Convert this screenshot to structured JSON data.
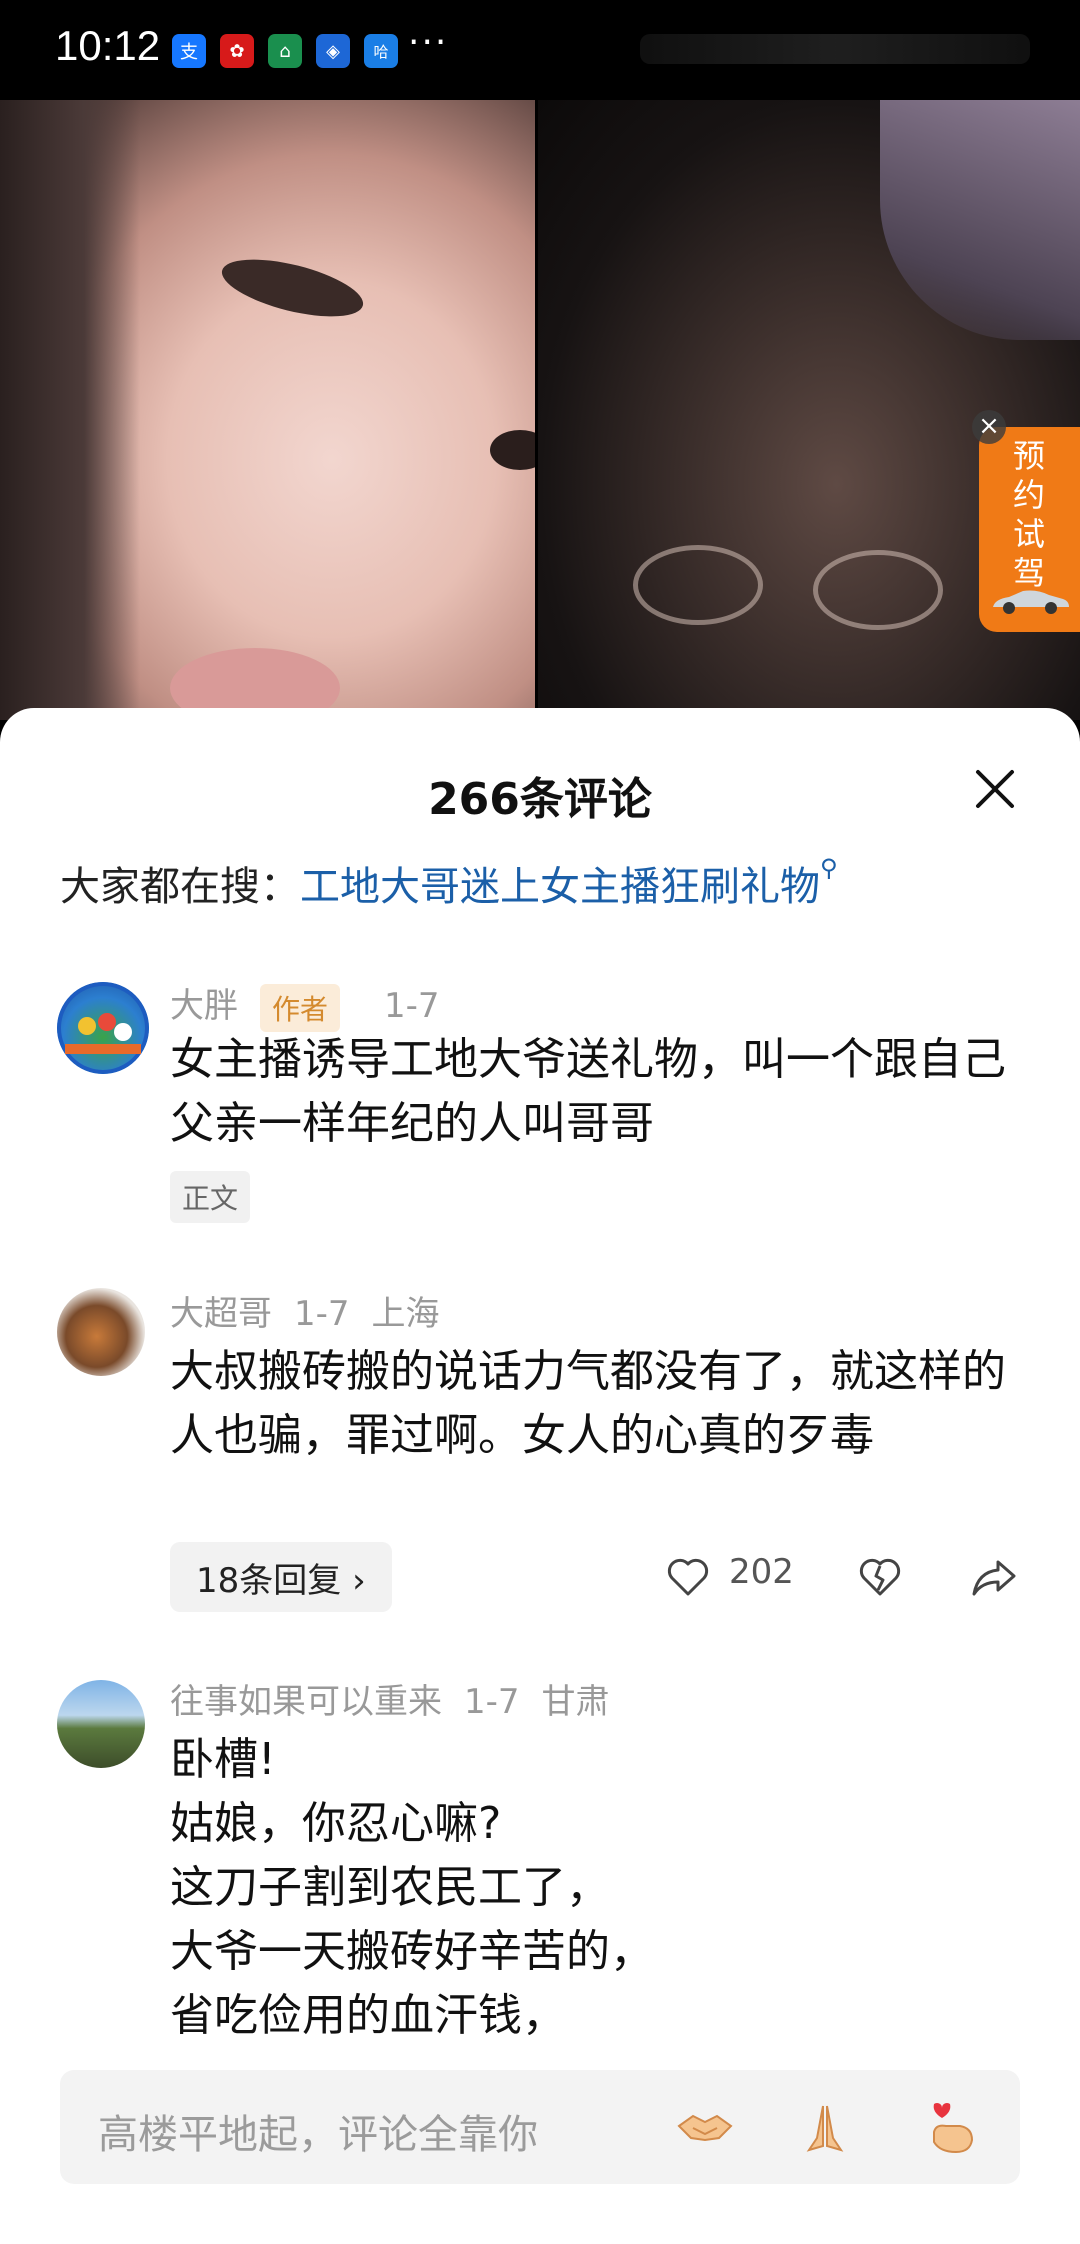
{
  "status_bar": {
    "time": "10:12",
    "icons": [
      {
        "name": "alipay-icon",
        "glyph": "支",
        "color": "#1677ff"
      },
      {
        "name": "huawei-icon",
        "glyph": "✿",
        "color": "#d71a1a"
      },
      {
        "name": "home-app-icon",
        "glyph": "⌂",
        "color": "#1a8f4e"
      },
      {
        "name": "app-icon",
        "glyph": "◈",
        "color": "#1d67d6"
      },
      {
        "name": "hello-app-icon",
        "glyph": "哈",
        "color": "#1a7ee6"
      }
    ],
    "more": "···"
  },
  "ad": {
    "text": "预约试驾",
    "close_glyph": "×"
  },
  "comments_panel": {
    "title": "266条评论",
    "search_prefix": "大家都在搜：",
    "search_link": "工地大哥迷上女主播狂刷礼物",
    "search_icon_glyph": "⚲"
  },
  "comments": [
    {
      "user": "大胖",
      "badge": "作者",
      "date": "1-7",
      "location": "",
      "text": "女主播诱导工地大爷送礼物，叫一个跟自己父亲一样年纪的人叫哥哥",
      "tag": "正文"
    },
    {
      "user": "大超哥",
      "date": "1-7",
      "location": "上海",
      "text": "大叔搬砖搬的说话力气都没有了，就这样的人也骗，罪过啊。女人的心真的歹毒",
      "replies_label": "18条回复 ›",
      "likes": "202"
    },
    {
      "user": "往事如果可以重来",
      "date": "1-7",
      "location": "甘肃",
      "lines": [
        "卧槽!",
        "姑娘，你忍心嘛?",
        "这刀子割到农民工了，",
        "大爷一天搬砖好辛苦的，",
        "省吃俭用的血汗钱，"
      ]
    }
  ],
  "input_bar": {
    "placeholder": "高楼平地起，评论全靠你"
  }
}
